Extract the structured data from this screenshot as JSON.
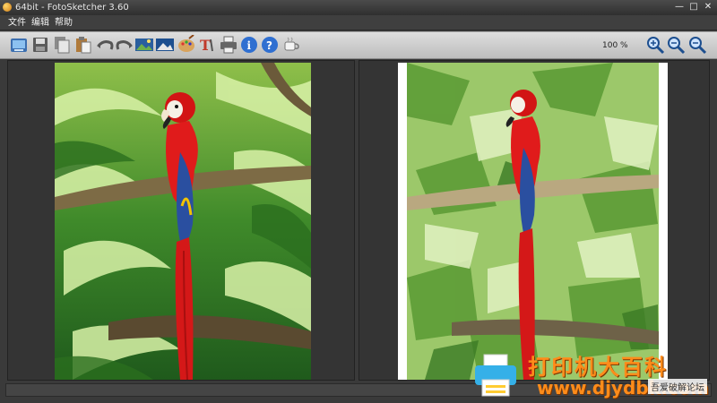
{
  "window": {
    "title": "64bit - FotoSketcher 3.60",
    "controls": [
      "—",
      "□",
      "✕"
    ]
  },
  "menubar": {
    "items": [
      "文件",
      "编辑",
      "帮助"
    ]
  },
  "toolbar": {
    "zoom": "100 %",
    "buttons": [
      "open-icon",
      "save-icon",
      "copy-icon",
      "paste-icon",
      "undo-icon",
      "redo-icon",
      "original-image-icon",
      "sketch-image-icon",
      "palette-icon",
      "text-icon",
      "print-icon",
      "info-icon",
      "help-icon",
      "coffee-icon",
      "zoom-in-icon",
      "zoom-reset-icon",
      "zoom-out-icon"
    ]
  },
  "overlay": {
    "brand": "打印机大百科",
    "url": "www.djydbk.com",
    "badge": "吾爱破解论坛"
  }
}
